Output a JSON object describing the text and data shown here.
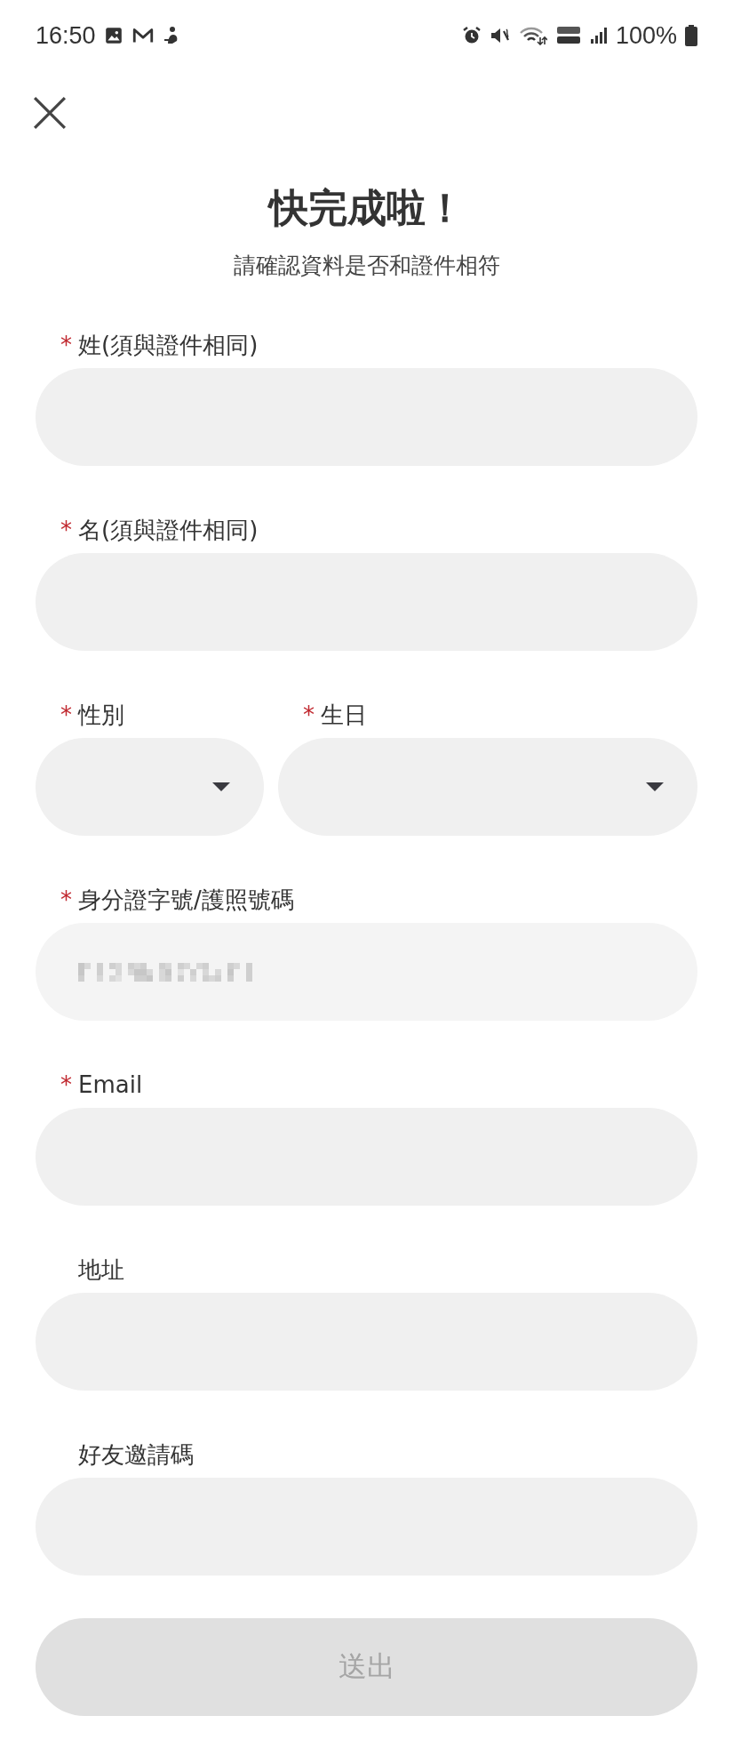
{
  "status_bar": {
    "time": "16:50",
    "battery": "100%"
  },
  "title": "快完成啦！",
  "subtitle": "請確認資料是否和證件相符",
  "rows": [
    {
      "fields": [
        {
          "mark": "*",
          "label": "姓(須與證件相同)",
          "kind": "text"
        }
      ]
    },
    {
      "fields": [
        {
          "mark": "*",
          "label": "名(須與證件相同)",
          "kind": "text"
        }
      ]
    },
    {
      "fields": [
        {
          "mark": "*",
          "label": "性別",
          "kind": "select"
        },
        {
          "mark": "*",
          "label": "生日",
          "kind": "select"
        }
      ]
    },
    {
      "fields": [
        {
          "mark": "*",
          "label": "身分證字號/護照號碼",
          "kind": "masked"
        }
      ]
    },
    {
      "fields": [
        {
          "mark": "*",
          "label": "Email",
          "kind": "text"
        }
      ]
    },
    {
      "fields": [
        {
          "label": "地址",
          "kind": "text"
        }
      ]
    },
    {
      "fields": [
        {
          "label": "好友邀請碼",
          "kind": "text"
        }
      ]
    }
  ],
  "submit": {
    "label": "送出",
    "disabled": true
  }
}
